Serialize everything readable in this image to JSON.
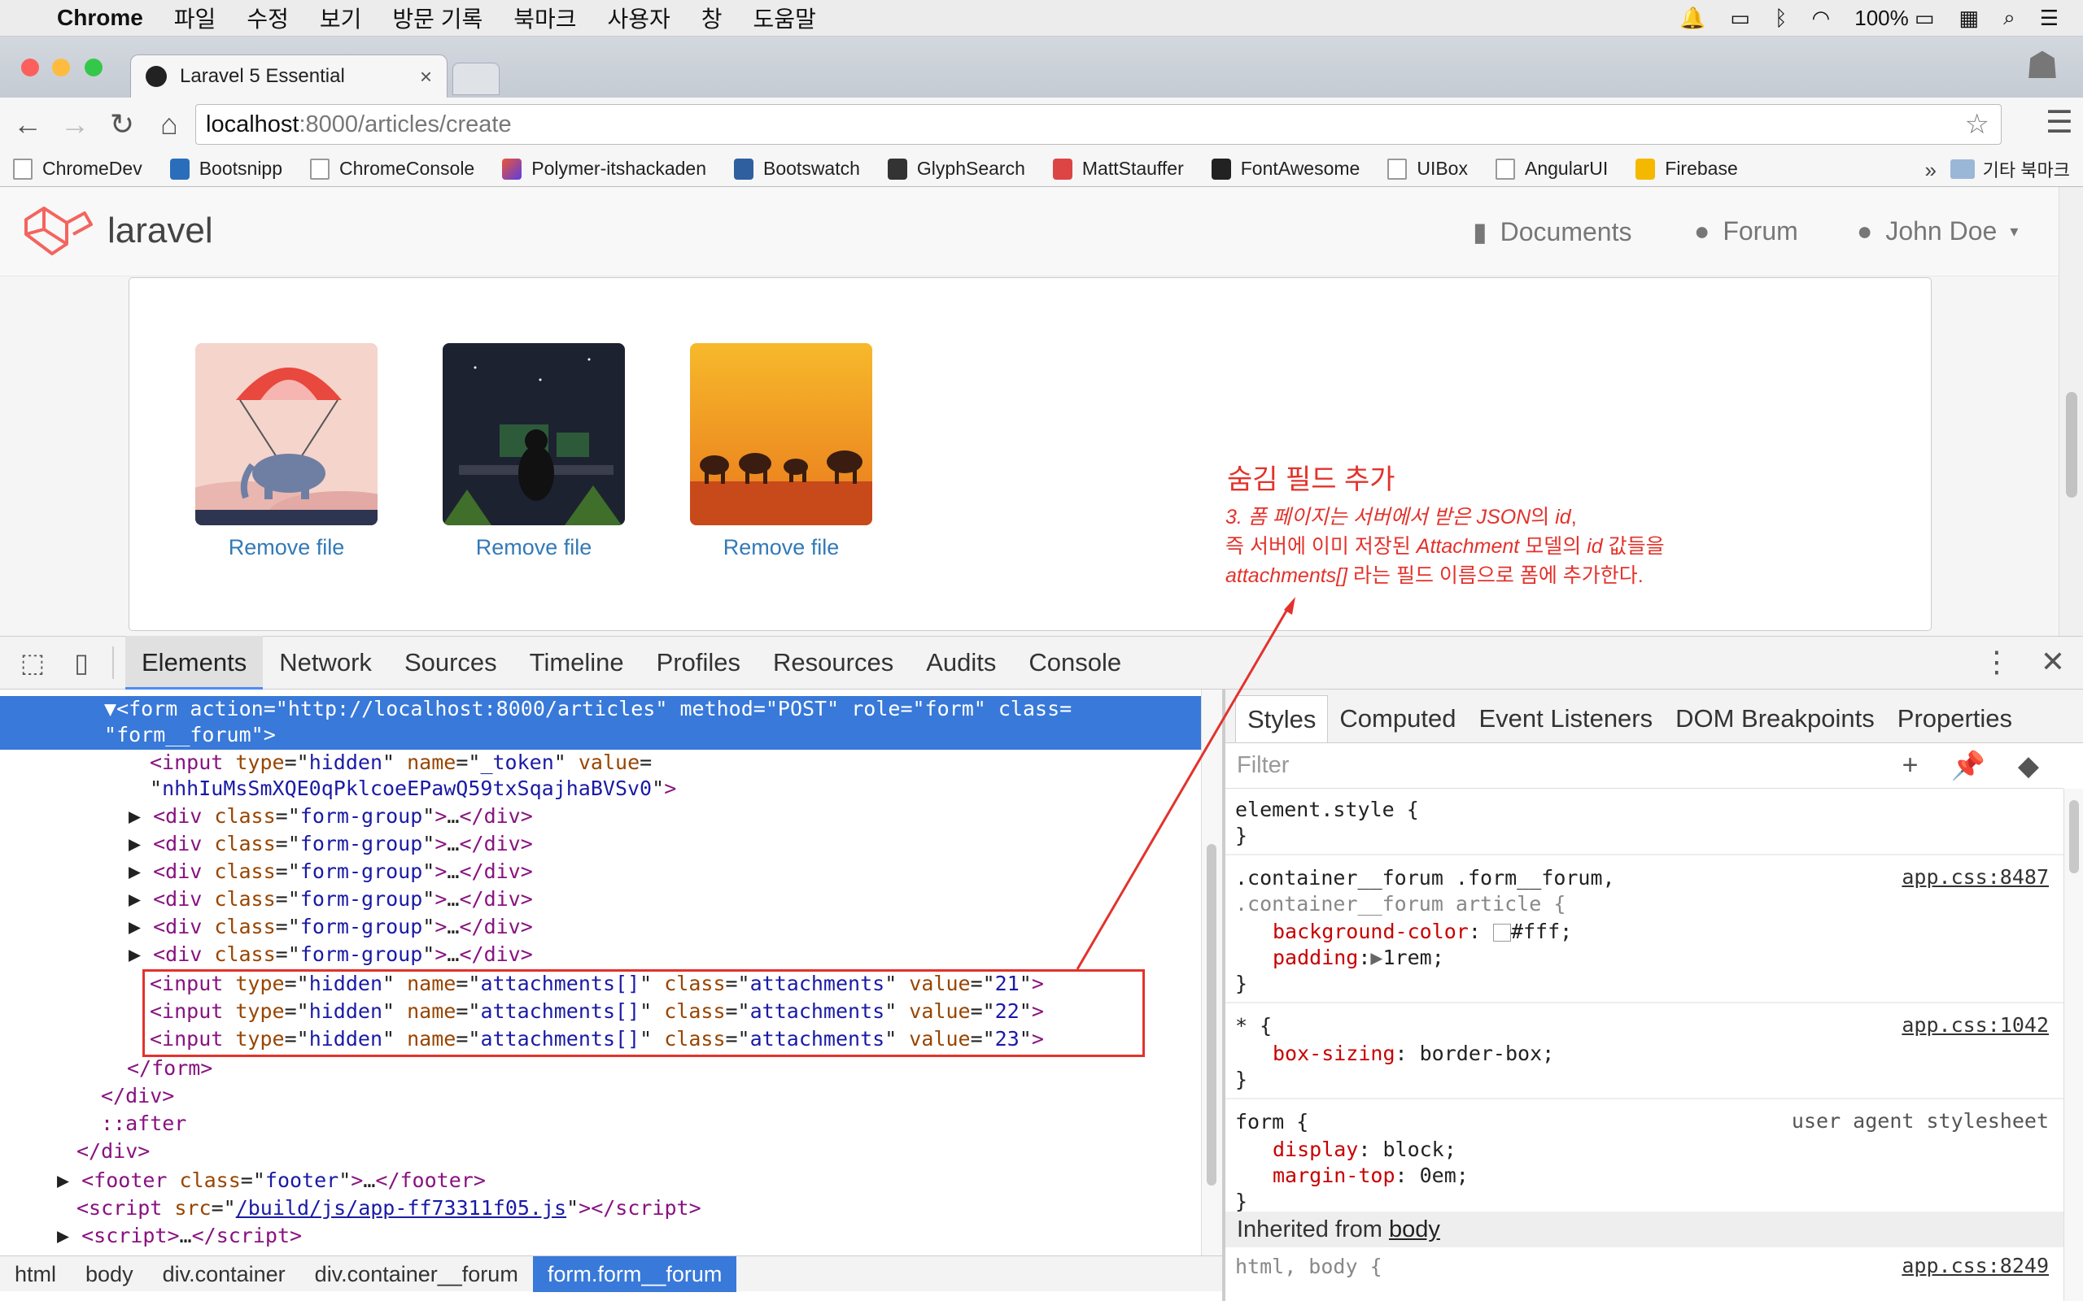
{
  "menubar": {
    "app": "Chrome",
    "items": [
      "파일",
      "수정",
      "보기",
      "방문 기록",
      "북마크",
      "사용자",
      "창",
      "도움말"
    ],
    "battery": "100%"
  },
  "tab": {
    "title": "Laravel 5 Essential"
  },
  "address": {
    "host": "localhost",
    "rest": ":8000/articles/create"
  },
  "bookmarks": [
    {
      "label": "ChromeDev"
    },
    {
      "label": "Bootsnipp"
    },
    {
      "label": "ChromeConsole"
    },
    {
      "label": "Polymer-itshackaden"
    },
    {
      "label": "Bootswatch"
    },
    {
      "label": "GlyphSearch"
    },
    {
      "label": "MattStauffer"
    },
    {
      "label": "FontAwesome"
    },
    {
      "label": "UIBox"
    },
    {
      "label": "AngularUI"
    },
    {
      "label": "Firebase"
    }
  ],
  "bookmarks_more": "»",
  "bookmarks_other": "기타 북마크",
  "site": {
    "brand": "laravel",
    "nav": {
      "documents": "Documents",
      "forum": "Forum",
      "user": "John Doe"
    }
  },
  "dropzone": {
    "remove_label": "Remove file"
  },
  "annotation": {
    "title": "숨김 필드 추가",
    "line1_a": "3. 폼 페이지는 서버에서 받은 ",
    "line1_b": "JSON",
    "line1_c": "의 ",
    "line1_d": "id",
    "line1_e": ",",
    "line2_a": "즉 서버에 이미 저장된 ",
    "line2_b": "Attachment",
    "line2_c": " 모델의 ",
    "line2_d": "id",
    "line2_e": " 값들을",
    "line3_a": "attachments[]",
    "line3_b": " 라는 필드 이름으로 폼에 추가한다."
  },
  "devtools": {
    "tabs": [
      "Elements",
      "Network",
      "Sources",
      "Timeline",
      "Profiles",
      "Resources",
      "Audits",
      "Console"
    ],
    "active_tab": "Elements",
    "dom": {
      "form_action": "http://localhost:8000/articles",
      "form_method": "POST",
      "form_role": "form",
      "form_class": "form__forum",
      "token_name": "_token",
      "token_value": "nhhIuMsSmXQE0qPklcoeEPawQ59txSqajhaBVSv0",
      "group_class": "form-group",
      "attach_name": "attachments[]",
      "attach_class": "attachments",
      "attach_values": [
        "21",
        "22",
        "23"
      ],
      "after": "::after",
      "footer_class": "footer",
      "script_src": "/build/js/app-ff73311f05.js"
    },
    "breadcrumbs": [
      "html",
      "body",
      "div.container",
      "div.container__forum",
      "form.form__forum"
    ],
    "styles_tabs": [
      "Styles",
      "Computed",
      "Event Listeners",
      "DOM Breakpoints",
      "Properties"
    ],
    "filter_placeholder": "Filter",
    "rules": {
      "element_style": "element.style {",
      "r1_sel1": ".container__forum .form__forum,",
      "r1_sel2": ".container__forum article {",
      "r1_src": "app.css:8487",
      "bg_prop": "background-color",
      "bg_val": "#fff;",
      "pad_prop": "padding",
      "pad_val": "1rem;",
      "r2_sel": "* {",
      "r2_src": "app.css:1042",
      "bs_prop": "box-sizing",
      "bs_val": "border-box;",
      "r3_sel": "form {",
      "r3_src": "user agent stylesheet",
      "disp_prop": "display",
      "disp_val": "block;",
      "mt_prop": "margin-top",
      "mt_val": "0em;",
      "inherited_label": "Inherited from",
      "inherited_el": "body",
      "r4_sel": "html, body {",
      "r4_src": "app.css:8249"
    }
  }
}
